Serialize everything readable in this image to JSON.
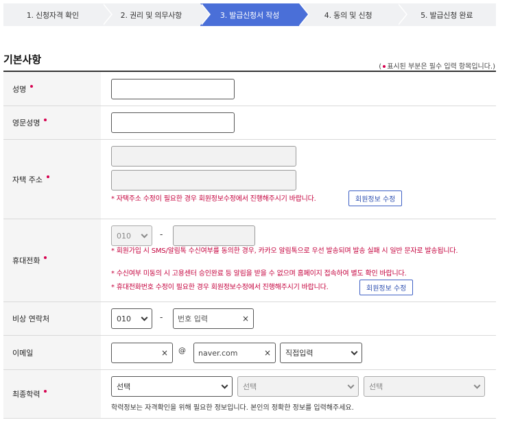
{
  "steps": [
    {
      "label": "1. 신청자격 확인",
      "active": false
    },
    {
      "label": "2. 권리 및 의무사항",
      "active": false
    },
    {
      "label": "3. 발급신청서 작성",
      "active": true
    },
    {
      "label": "4. 동의 및 신청",
      "active": false
    },
    {
      "label": "5. 발급신청 완료",
      "active": false
    }
  ],
  "section": {
    "title": "기본사항",
    "required_note_prefix": "(",
    "required_note": "표시된 부분은 필수 입력 항목입니다.)"
  },
  "fields": {
    "name": {
      "label": "성명",
      "value": ""
    },
    "english_name": {
      "label": "영문성명",
      "value": ""
    },
    "address": {
      "label": "자택 주소",
      "line1": "",
      "line2": "",
      "notice": "* 자택주소 수정이 필요한 경우 회원정보수정에서 진행해주시기 바랍니다.",
      "button": "회원정보 수정"
    },
    "mobile": {
      "label": "휴대전화",
      "prefix": "010",
      "number": "",
      "dash": "-",
      "notice1": "* 회원가입 시 SMS/알림톡 수신여부를 동의한 경우, 카카오 알림톡으로 우선 발송되며 발송 실패 시 일반 문자로 발송됩니다.",
      "notice2": "* 수신여부 미동의 시 고용센터 승인완료 등 알림을 받을 수 없으며 홈페이지 접속하여 별도 확인 바랍니다.",
      "notice3": "* 휴대전화번호 수정이 필요한 경우 회원정보수정에서 진행해주시기 바랍니다.",
      "button": "회원정보 수정"
    },
    "emergency": {
      "label": "비상 연락처",
      "prefix": "010",
      "dash": "-",
      "placeholder": "번호 입력",
      "clear": "×"
    },
    "email": {
      "label": "이메일",
      "local": "",
      "at": "@",
      "domain": "naver.com",
      "domain_select": "직접입력",
      "clear": "×"
    },
    "education": {
      "label": "최종학력",
      "select1": "선택",
      "select2": "선택",
      "select3": "선택",
      "help": "학력정보는 자격확인을 위해 필요한 정보입니다. 본인의 정확한 정보를 입력해주세요."
    }
  },
  "colors": {
    "active_step": "#4a6fd8",
    "step_bg": "#f0f1f3",
    "required_dot": "#d6004f",
    "warning_text": "#c4003c",
    "button_border": "#3d5fc4"
  }
}
